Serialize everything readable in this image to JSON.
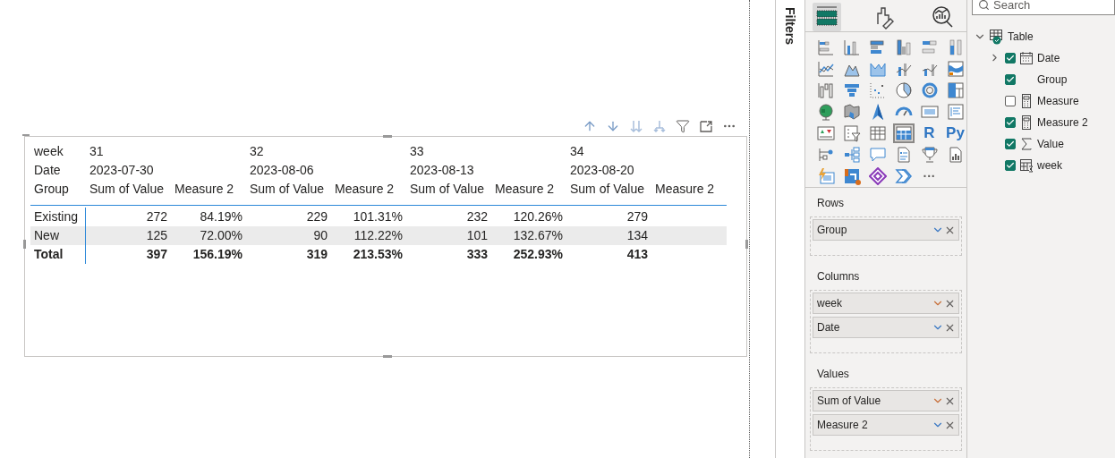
{
  "visual_header": {
    "buttons": [
      {
        "kind": "up"
      },
      {
        "kind": "down"
      },
      {
        "kind": "expand-down"
      },
      {
        "kind": "drill"
      },
      {
        "kind": "filter"
      },
      {
        "kind": "focus"
      },
      {
        "kind": "more"
      }
    ]
  },
  "matrix": {
    "row_header_labels": [
      "week",
      "Date",
      "Group"
    ],
    "column_groups": [
      {
        "week": "31",
        "date": "2023-07-30",
        "measures": [
          "Sum of Value",
          "Measure 2"
        ]
      },
      {
        "week": "32",
        "date": "2023-08-06",
        "measures": [
          "Sum of Value",
          "Measure 2"
        ]
      },
      {
        "week": "33",
        "date": "2023-08-13",
        "measures": [
          "Sum of Value",
          "Measure 2"
        ]
      },
      {
        "week": "34",
        "date": "2023-08-20",
        "measures": [
          "Sum of Value",
          "Measure 2"
        ]
      }
    ],
    "rows": [
      {
        "kind": "data",
        "label": "Existing",
        "shaded": false,
        "cells": [
          "272",
          "84.19%",
          "229",
          "101.31%",
          "232",
          "120.26%",
          "279"
        ]
      },
      {
        "kind": "data",
        "label": "New",
        "shaded": true,
        "cells": [
          "125",
          "72.00%",
          "90",
          "112.22%",
          "101",
          "132.67%",
          "134"
        ]
      },
      {
        "kind": "total",
        "label": "Total",
        "shaded": false,
        "cells": [
          "397",
          "156.19%",
          "319",
          "213.53%",
          "333",
          "252.93%",
          "413"
        ]
      }
    ]
  },
  "filters_pane": {
    "title": "Filters"
  },
  "visualizations": {
    "tabs": [
      {
        "selected": true
      },
      {
        "selected": false
      },
      {
        "selected": false
      }
    ],
    "gallery": [
      {
        "kind": "icon",
        "selected": false
      },
      {
        "kind": "icon",
        "selected": false
      },
      {
        "kind": "icon",
        "selected": false
      },
      {
        "kind": "icon",
        "selected": false
      },
      {
        "kind": "icon",
        "selected": false
      },
      {
        "kind": "icon",
        "selected": false
      },
      {
        "kind": "icon",
        "selected": false
      },
      {
        "kind": "icon",
        "selected": false
      },
      {
        "kind": "icon",
        "selected": false
      },
      {
        "kind": "icon",
        "selected": false
      },
      {
        "kind": "icon",
        "selected": false
      },
      {
        "kind": "icon",
        "selected": false
      },
      {
        "kind": "icon",
        "selected": false
      },
      {
        "kind": "icon",
        "selected": false
      },
      {
        "kind": "icon",
        "selected": false
      },
      {
        "kind": "icon",
        "selected": false
      },
      {
        "kind": "icon",
        "selected": false
      },
      {
        "kind": "icon",
        "selected": false
      },
      {
        "kind": "icon",
        "selected": false
      },
      {
        "kind": "icon",
        "selected": false
      },
      {
        "kind": "icon",
        "selected": false
      },
      {
        "kind": "icon",
        "selected": false
      },
      {
        "kind": "icon",
        "selected": false
      },
      {
        "kind": "icon",
        "selected": false
      },
      {
        "kind": "icon",
        "selected": false
      },
      {
        "kind": "icon",
        "selected": false
      },
      {
        "kind": "icon",
        "selected": false
      },
      {
        "kind": "icon",
        "selected": true
      },
      {
        "kind": "text",
        "label": "R",
        "selected": false
      },
      {
        "kind": "text",
        "label": "Py",
        "selected": false
      },
      {
        "kind": "icon",
        "selected": false
      },
      {
        "kind": "icon",
        "selected": false
      },
      {
        "kind": "icon",
        "selected": false
      },
      {
        "kind": "icon",
        "selected": false
      },
      {
        "kind": "icon",
        "selected": false
      },
      {
        "kind": "icon",
        "selected": false
      },
      {
        "kind": "icon",
        "selected": false
      },
      {
        "kind": "icon",
        "selected": false
      },
      {
        "kind": "icon",
        "selected": false
      },
      {
        "kind": "icon",
        "selected": false
      },
      {
        "kind": "text",
        "label": "···",
        "selected": false
      }
    ],
    "wells": [
      {
        "title": "Rows",
        "chips": [
          {
            "label": "Group",
            "color": "#3a78c3"
          }
        ]
      },
      {
        "title": "Columns",
        "chips": [
          {
            "label": "week",
            "color": "#c8703a"
          },
          {
            "label": "Date",
            "color": "#3a78c3"
          }
        ]
      },
      {
        "title": "Values",
        "chips": [
          {
            "label": "Sum of Value",
            "color": "#c8703a"
          },
          {
            "label": "Measure 2",
            "color": "#3a78c3"
          }
        ]
      }
    ]
  },
  "fields": {
    "search": {
      "placeholder": "Search"
    },
    "table": {
      "label": "Table",
      "expanded": true,
      "children": [
        {
          "label": "Date",
          "kind": "date",
          "checked": true,
          "expanded": false
        },
        {
          "label": "Group",
          "kind": "text",
          "checked": true
        },
        {
          "label": "Measure",
          "kind": "measure",
          "checked": false
        },
        {
          "label": "Measure 2",
          "kind": "measure",
          "checked": true
        },
        {
          "label": "Value",
          "kind": "sum",
          "checked": true
        },
        {
          "label": "week",
          "kind": "hierarchy",
          "checked": true
        }
      ]
    }
  }
}
